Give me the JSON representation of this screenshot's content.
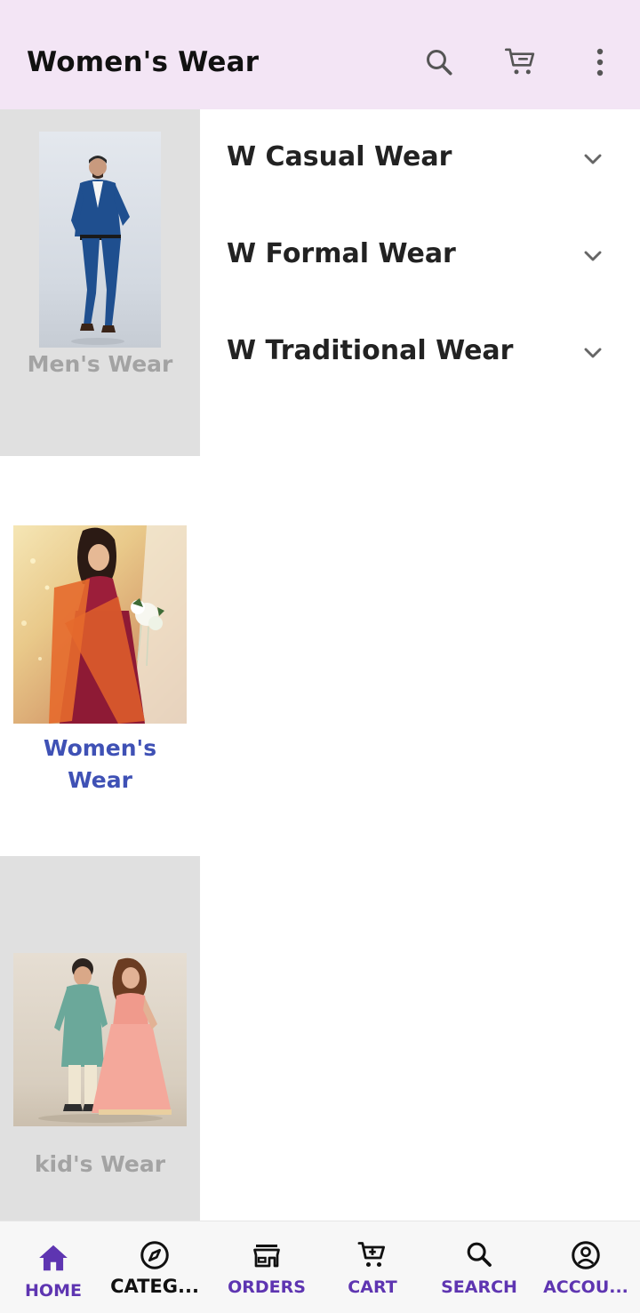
{
  "app_bar": {
    "title": "Women's Wear",
    "icons": [
      "search-icon",
      "cart-icon",
      "more-vert-icon"
    ],
    "background": "#f3e5f5"
  },
  "categories": [
    {
      "label": "Men's Wear",
      "state": "inactive"
    },
    {
      "label": "Women's Wear",
      "state": "selected"
    },
    {
      "label": "kid's Wear",
      "state": "inactive"
    }
  ],
  "subcategories": [
    {
      "label": "W Casual Wear",
      "icon": "chevron-down-icon"
    },
    {
      "label": "W Formal Wear",
      "icon": "chevron-down-icon"
    },
    {
      "label": "W Traditional Wear",
      "icon": "chevron-down-icon"
    }
  ],
  "bottom_nav": [
    {
      "label": "HOME",
      "icon": "home-icon"
    },
    {
      "label": "CATEG...",
      "icon": "compass-icon"
    },
    {
      "label": "ORDERS",
      "icon": "store-icon"
    },
    {
      "label": "CART",
      "icon": "cart-icon"
    },
    {
      "label": "SEARCH",
      "icon": "search-icon"
    },
    {
      "label": "ACCOU...",
      "icon": "account-icon"
    }
  ],
  "colors": {
    "accent": "#5e35b1",
    "selected_category": "#3f51b5",
    "inactive_category_bg": "#e0e0e0"
  }
}
